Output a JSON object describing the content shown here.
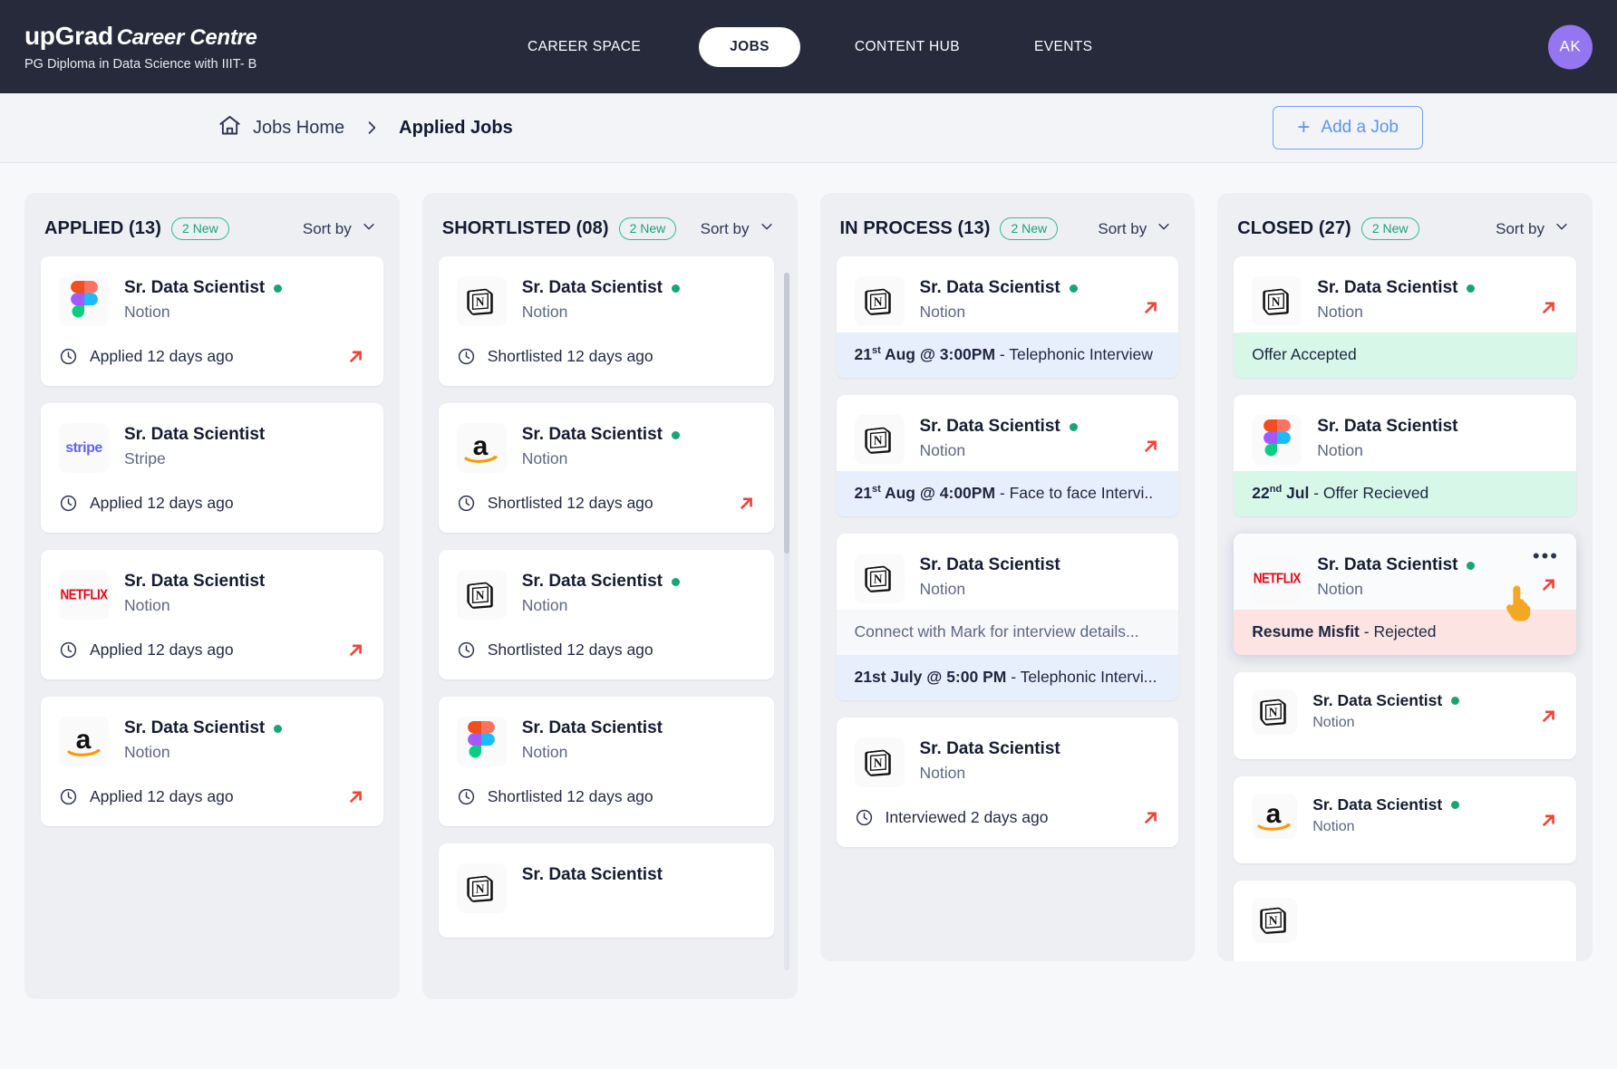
{
  "header": {
    "brand_name": "upGrad",
    "brand_suffix": "Career Centre",
    "program": "PG Diploma in Data Science with IIIT- B",
    "nav": [
      {
        "label": "CAREER SPACE",
        "active": false
      },
      {
        "label": "JOBS",
        "active": true
      },
      {
        "label": "CONTENT HUB",
        "active": false
      },
      {
        "label": "EVENTS",
        "active": false
      }
    ],
    "avatar_initials": "AK"
  },
  "breadcrumb": {
    "home_label": "Jobs Home",
    "current_label": "Applied Jobs",
    "add_job_label": "Add a Job",
    "add_job_plus": "+"
  },
  "sort_label": "Sort by",
  "columns": [
    {
      "title": "APPLIED (13)",
      "new_badge": "2 New",
      "cards": [
        {
          "logo": "figma",
          "title": "Sr. Data Scientist",
          "company": "Notion",
          "dot": true,
          "foot": "Applied 12 days ago",
          "arrow": true
        },
        {
          "logo": "stripe",
          "title": "Sr. Data Scientist",
          "company": "Stripe",
          "dot": false,
          "foot": "Applied 12 days ago",
          "arrow": false
        },
        {
          "logo": "netflix",
          "title": "Sr. Data Scientist",
          "company": "Notion",
          "dot": false,
          "foot": "Applied 12 days ago",
          "arrow": true
        },
        {
          "logo": "amazon",
          "title": "Sr. Data Scientist",
          "company": "Notion",
          "dot": true,
          "foot": "Applied 12 days ago",
          "arrow": true
        }
      ]
    },
    {
      "title": "SHORTLISTED (08)",
      "new_badge": "2 New",
      "cards": [
        {
          "logo": "notion",
          "title": "Sr. Data Scientist",
          "company": "Notion",
          "dot": true,
          "foot": "Shortlisted 12 days ago",
          "arrow": false
        },
        {
          "logo": "amazon",
          "title": "Sr. Data Scientist",
          "company": "Notion",
          "dot": true,
          "foot": "Shortlisted 12 days ago",
          "arrow": true
        },
        {
          "logo": "notion",
          "title": "Sr. Data Scientist",
          "company": "Notion",
          "dot": true,
          "foot": "Shortlisted 12 days ago",
          "arrow": false
        },
        {
          "logo": "figma",
          "title": "Sr. Data Scientist",
          "company": "Notion",
          "dot": false,
          "foot": "Shortlisted 12 days ago",
          "arrow": false
        },
        {
          "logo": "notion",
          "title": "Sr. Data Scientist",
          "company": "",
          "dot": false,
          "foot": "",
          "arrow": false
        }
      ]
    },
    {
      "title": "IN PROCESS (13)",
      "new_badge": "2 New",
      "cards": [
        {
          "logo": "notion",
          "title": "Sr. Data Scientist",
          "company": "Notion",
          "dot": true,
          "arrow": true,
          "band": {
            "style": "blue",
            "bold": "21st Aug @ 3:00PM",
            "bold_sup": "st",
            "bold_pre": "21",
            "bold_post": " Aug @ 3:00PM",
            "rest": " - Telephonic Interview"
          }
        },
        {
          "logo": "notion",
          "title": "Sr. Data Scientist",
          "company": "Notion",
          "dot": true,
          "arrow": true,
          "band": {
            "style": "blue",
            "bold_pre": "21",
            "bold_sup": "st",
            "bold_post": " Aug @ 4:00PM",
            "rest": " - Face to face Intervi.."
          }
        },
        {
          "logo": "notion",
          "title": "Sr. Data Scientist",
          "company": "Notion",
          "dot": false,
          "arrow": false,
          "note": "Connect with Mark for interview details...",
          "band": {
            "style": "blue",
            "bold_pre": "21st July @ 5:00 PM",
            "bold_sup": "",
            "bold_post": "",
            "rest": " - Telephonic Intervi..."
          }
        },
        {
          "logo": "notion",
          "title": "Sr. Data Scientist",
          "company": "Notion",
          "dot": false,
          "foot": "Interviewed 2 days ago",
          "arrow": true
        }
      ]
    },
    {
      "title": "CLOSED (27)",
      "new_badge": "2 New",
      "cards": [
        {
          "logo": "notion",
          "title": "Sr. Data Scientist",
          "company": "Notion",
          "dot": true,
          "arrow": true,
          "band": {
            "style": "green",
            "bold_pre": "",
            "bold_sup": "",
            "bold_post": "",
            "rest": "Offer Accepted"
          }
        },
        {
          "logo": "figma",
          "title": "Sr. Data Scientist",
          "company": "Notion",
          "dot": false,
          "arrow": false,
          "band": {
            "style": "green",
            "bold_pre": "22",
            "bold_sup": "nd",
            "bold_post": " Jul",
            "rest": " - Offer Recieved"
          }
        },
        {
          "logo": "netflix",
          "title": "Sr. Data Scientist",
          "company": "Notion",
          "dot": true,
          "arrow": true,
          "hovered": true,
          "menu": "•••",
          "band": {
            "style": "red",
            "bold_pre": "Resume Misfit",
            "bold_sup": "",
            "bold_post": "",
            "rest": " - Rejected"
          }
        },
        {
          "logo": "notion",
          "title": "Sr. Data Scientist",
          "company": "Notion",
          "dot": true,
          "arrow": true,
          "compact": true
        },
        {
          "logo": "amazon",
          "title": "Sr. Data Scientist",
          "company": "Notion",
          "dot": true,
          "arrow": true,
          "compact": true
        },
        {
          "logo": "notion",
          "title": "",
          "company": "",
          "dot": false,
          "arrow": false,
          "compact": true
        }
      ]
    }
  ],
  "colors": {
    "header_bg": "#262A3B",
    "accent_blue": "#5B94F5",
    "green": "#16A672",
    "red_arrow": "#F04438",
    "band_blue": "#E8EFFC",
    "band_green": "#D7F7E9",
    "band_red": "#FBE4E2",
    "avatar": "#9575F0"
  }
}
